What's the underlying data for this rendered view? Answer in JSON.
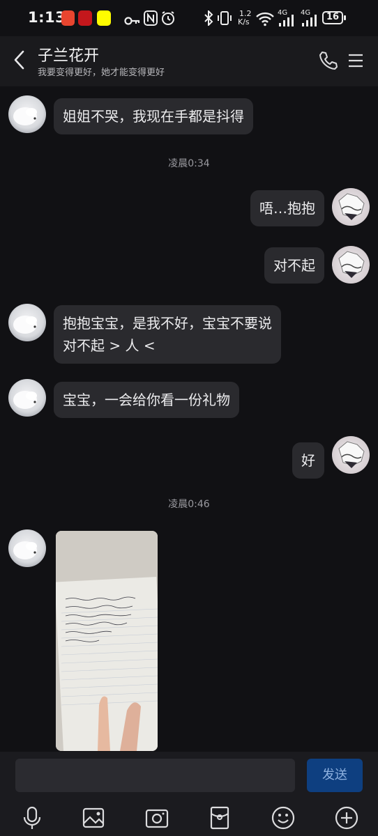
{
  "status_bar": {
    "time": "1:13",
    "network_speed_value": "1.2",
    "network_speed_unit": "K/s",
    "network_1": "4G",
    "network_2": "4G",
    "battery": "16",
    "icons": [
      "notification-red-app-icon",
      "notification-red-app-icon-2",
      "snapchat-icon",
      "key-icon",
      "nfc-icon",
      "alarm-icon",
      "bluetooth-icon",
      "vibrate-icon",
      "wifi-icon",
      "signal-icon",
      "signal-icon-2",
      "battery-icon"
    ]
  },
  "header": {
    "title": "子兰花开",
    "subtitle": "我要变得更好，她才能变得更好",
    "icons": [
      "back-chevron-icon",
      "phone-icon",
      "menu-icon"
    ]
  },
  "messages": [
    {
      "side": "left",
      "text": "姐姐不哭，我现在手都是抖得"
    },
    {
      "type": "time",
      "text": "凌晨0:34"
    },
    {
      "side": "right",
      "text": "唔…抱抱"
    },
    {
      "side": "right",
      "text": "对不起"
    },
    {
      "side": "left",
      "text_line1": "抱抱宝宝，是我不好，宝宝不要说",
      "text_line2": "对不起 > 人 <"
    },
    {
      "side": "left",
      "text": "宝宝，一会给你看一份礼物"
    },
    {
      "side": "right",
      "text": "好"
    },
    {
      "type": "time",
      "text": "凌晨0:46"
    },
    {
      "side": "left",
      "type": "image",
      "image": "photo-of-handwritten-note"
    }
  ],
  "composer": {
    "input_value": "",
    "input_placeholder": "",
    "send_label": "发送",
    "tools": [
      "microphone-icon",
      "image-icon",
      "camera-icon",
      "red-envelope-icon",
      "emoji-icon",
      "plus-icon"
    ]
  },
  "colors": {
    "background": "#111114",
    "bubble": "#2a2a2e",
    "send_button": "#0e3f80"
  }
}
